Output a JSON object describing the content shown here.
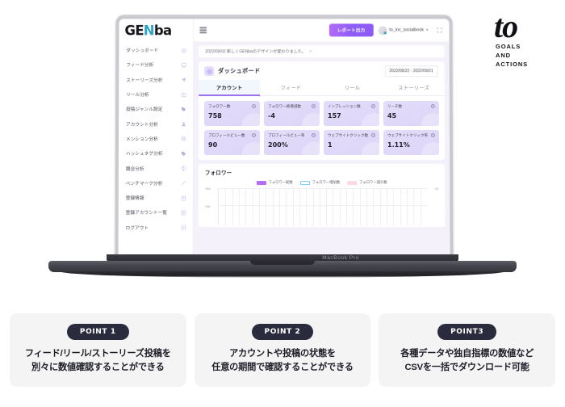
{
  "logo": {
    "mark_t": "t",
    "mark_o": "o",
    "sub_line1": "GOALS",
    "sub_line2": "AND",
    "sub_line3": "ACTIONS"
  },
  "device": {
    "label": "MacBook Pro"
  },
  "app": {
    "brand": {
      "part1": "GE",
      "part2": "N",
      "part3": "ba"
    },
    "sidebar": {
      "items": [
        {
          "label": "ダッシュボード",
          "icon": "gauge-icon"
        },
        {
          "label": "フィード分析",
          "icon": "feed-icon"
        },
        {
          "label": "ストーリーズ分析",
          "icon": "send-icon"
        },
        {
          "label": "リール分析",
          "icon": "reel-icon"
        },
        {
          "label": "投稿ジャンル設定",
          "icon": "tag-icon"
        },
        {
          "label": "アカウント分析",
          "icon": "person-icon"
        },
        {
          "label": "メンション分析",
          "icon": "at-icon"
        },
        {
          "label": "ハッシュタグ分析",
          "icon": "hashtag-icon"
        },
        {
          "label": "競合分析",
          "icon": "compare-icon"
        },
        {
          "label": "ベンチマーク分析",
          "icon": "trend-icon"
        },
        {
          "label": "登録情報",
          "icon": "card-icon"
        },
        {
          "label": "登録アカウント一覧",
          "icon": "list-icon"
        },
        {
          "label": "ログアウト",
          "icon": "logout-icon"
        }
      ]
    },
    "topbar": {
      "menu_icon": "hamburger-icon",
      "report_button": "レポート出力",
      "user_name": "to_inc_socialbook",
      "user_caret": "▾",
      "expand_icon": "expand-icon"
    },
    "notice": {
      "text": "2022/09/02 新しくGENbaのデザインが変わりました。",
      "close": "×"
    },
    "dashboard": {
      "icon": "gauge-icon",
      "title": "ダッシュボード",
      "date_range": "2022/08/22 - 2022/09/21",
      "tabs": [
        {
          "label": "アカウント",
          "active": true
        },
        {
          "label": "フィード",
          "active": false
        },
        {
          "label": "リール",
          "active": false
        },
        {
          "label": "ストーリーズ",
          "active": false
        }
      ],
      "cards": [
        {
          "label": "フォロワー数",
          "value": "758",
          "help": "?"
        },
        {
          "label": "フォロワー純増減数",
          "value": "-4",
          "help": "?"
        },
        {
          "label": "インプレッション数",
          "value": "157",
          "help": "?"
        },
        {
          "label": "リーチ数",
          "value": "45",
          "help": "?"
        },
        {
          "label": "プロフィールビュー数",
          "value": "90",
          "help": "?"
        },
        {
          "label": "プロフィールビュー率",
          "value": "200%",
          "help": "?"
        },
        {
          "label": "ウェブサイトクリック数",
          "value": "1",
          "help": "?"
        },
        {
          "label": "ウェブサイトクリック率",
          "value": "1.11%",
          "help": "?"
        }
      ]
    }
  },
  "chart_data": {
    "type": "line",
    "title": "フォロワー",
    "legend": [
      {
        "name": "フォロワー総数",
        "color": "#b66ef0",
        "style": "solid"
      },
      {
        "name": "フォロワー増加数",
        "color": "#ffffff",
        "border": "#7fc8f0",
        "style": "outline"
      },
      {
        "name": "フォロワー減少数",
        "color": "#ffd8e4",
        "style": "solid"
      }
    ],
    "ylabel_left_top": "784",
    "ylabel_left_mid": "780",
    "ylabel_right_top": "10",
    "ylim_left": [
      776,
      784
    ],
    "ylim_right": [
      0,
      10
    ],
    "grid": true,
    "legend_position": "top-center",
    "series": [
      {
        "name": "フォロワー総数",
        "values": []
      },
      {
        "name": "フォロワー増加数",
        "values": []
      },
      {
        "name": "フォロワー減少数",
        "values": []
      }
    ]
  },
  "points": [
    {
      "badge": "POINT 1",
      "line1": "フィード/リール/ストーリーズ投稿を",
      "line2": "別々に数値確認することができる"
    },
    {
      "badge": "POINT 2",
      "line1": "アカウントや投稿の状態を",
      "line2": "任意の期間で確認することができる"
    },
    {
      "badge": "POINT3",
      "line1": "各種データや独自指標の数値など",
      "line2": "CSVを一括でダウンロード可能"
    }
  ]
}
